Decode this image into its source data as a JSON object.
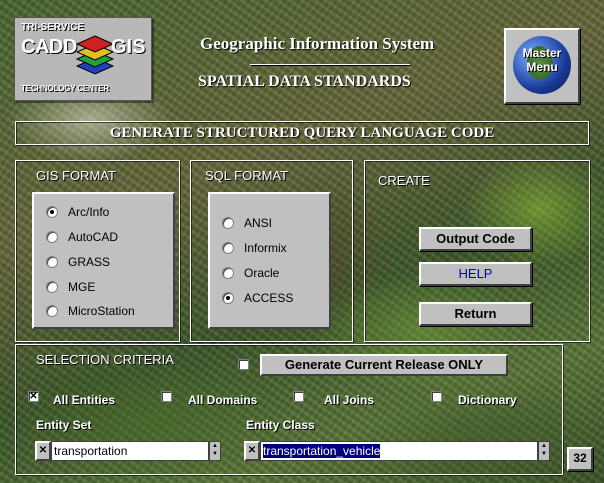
{
  "logo": {
    "line1": "TRI-SERVICE",
    "word1": "CADD",
    "word2": "GIS",
    "line3": "TECHNOLOGY CENTER"
  },
  "header": {
    "title": "Geographic Information System",
    "subtitle": "SPATIAL DATA STANDARDS"
  },
  "master_menu": {
    "line1": "Master",
    "line2": "Menu"
  },
  "banner": {
    "title": "GENERATE STRUCTURED QUERY LANGUAGE CODE"
  },
  "gis_format": {
    "label": "GIS FORMAT",
    "options": [
      "Arc/Info",
      "AutoCAD",
      "GRASS",
      "MGE",
      "MicroStation"
    ],
    "selected_index": 0
  },
  "sql_format": {
    "label": "SQL FORMAT",
    "options": [
      "ANSI",
      "Informix",
      "Oracle",
      "ACCESS"
    ],
    "selected_index": 3
  },
  "create": {
    "label": "CREATE",
    "output_code": "Output Code",
    "help": "HELP",
    "return": "Return"
  },
  "selection": {
    "label": "SELECTION CRITERIA",
    "current_release": "Generate Current Release ONLY",
    "all_entities": "All Entities",
    "all_domains": "All Domains",
    "all_joins": "All Joins",
    "dictionary": "Dictionary",
    "checked": {
      "current_release": false,
      "all_entities": true,
      "all_domains": false,
      "all_joins": false,
      "dictionary": false
    },
    "entity_set_label": "Entity Set",
    "entity_set_value": "transportation",
    "entity_class_label": "Entity Class",
    "entity_class_value": "transportation_vehicle"
  },
  "counter": "32",
  "colors": {
    "help_text": "#0000c0",
    "panel": "#c0c0c0"
  }
}
